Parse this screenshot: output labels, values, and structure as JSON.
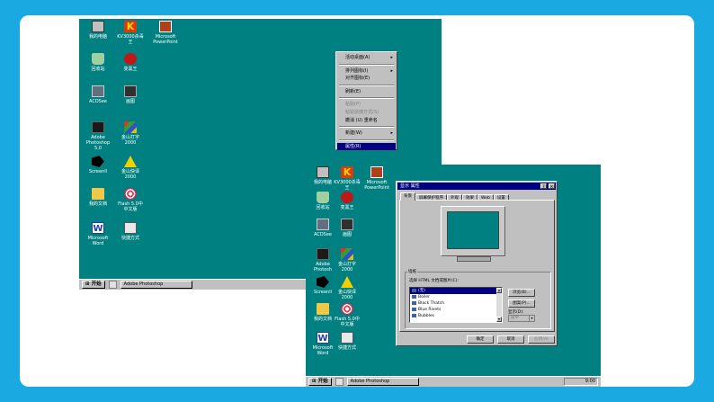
{
  "desktop1": {
    "icons": [
      "我的电脑",
      "KV3000杀毒王",
      "Microsoft\nPowerPoint",
      "回收站",
      "变黑王",
      "ACDSee",
      "画图",
      "Adobe\nPhotoshop\n5.0",
      "金山打字\n2000",
      "Screenll",
      "金山快译\n2000",
      "我的文档",
      "Flash 5.0中\n中文版",
      "Microsoft\nWord",
      "快捷方式"
    ],
    "taskbar": {
      "start": "开始",
      "task": "Adobe Photoshop"
    }
  },
  "desktop2": {
    "icons": [
      "我的电脑",
      "KV3000杀毒王",
      "Microsoft\nPowerPoint",
      "回收站",
      "变黑王",
      "ACDSee",
      "画图",
      "Adobe\nPhotosh",
      "金山打字\n2000",
      "Screenll",
      "金山快译\n2000",
      "我的文档",
      "Flash 5.0中\n中文版",
      "Microsoft\nWord",
      "快捷方式"
    ],
    "taskbar": {
      "start": "开始",
      "task": "Adobe Photoshop",
      "clock": "9:00"
    }
  },
  "context_menu": {
    "items": [
      {
        "label": "活动桌面(A)",
        "state": "normal",
        "submenu": true
      },
      {
        "label": "排列图标(I)",
        "state": "normal",
        "submenu": true
      },
      {
        "label": "对齐图标(E)",
        "state": "normal",
        "submenu": false
      },
      {
        "label": "刷新(E)",
        "state": "normal",
        "submenu": false
      },
      {
        "label": "粘贴(P)",
        "state": "disabled",
        "submenu": false
      },
      {
        "label": "粘贴快捷方式(S)",
        "state": "disabled",
        "submenu": false
      },
      {
        "label": "撤消 (U) 重命名",
        "state": "normal",
        "submenu": false
      },
      {
        "label": "新建(W)",
        "state": "normal",
        "submenu": true
      },
      {
        "label": "属性(R)",
        "state": "selected",
        "submenu": false
      }
    ]
  },
  "dialog": {
    "title": "显示 属性",
    "help": "?",
    "close": "×",
    "tabs": [
      "背景",
      "屏幕保护程序",
      "外观",
      "效果",
      "Web",
      "设置"
    ],
    "group_label": "墙纸",
    "list_label": "选择 HTML 文档或图片(C):",
    "wallpapers": [
      {
        "name": "(无)",
        "selected": true
      },
      {
        "name": "Boiler",
        "selected": false
      },
      {
        "name": "Black Thatch",
        "selected": false
      },
      {
        "name": "Blue Rivets",
        "selected": false
      },
      {
        "name": "Bubbles",
        "selected": false
      }
    ],
    "browse": "浏览(B)...",
    "pattern": "图案(P)...",
    "display_label": "显示(D):",
    "display_value": "居中",
    "ok": "确定",
    "cancel": "取消",
    "apply": "应用(A)"
  }
}
